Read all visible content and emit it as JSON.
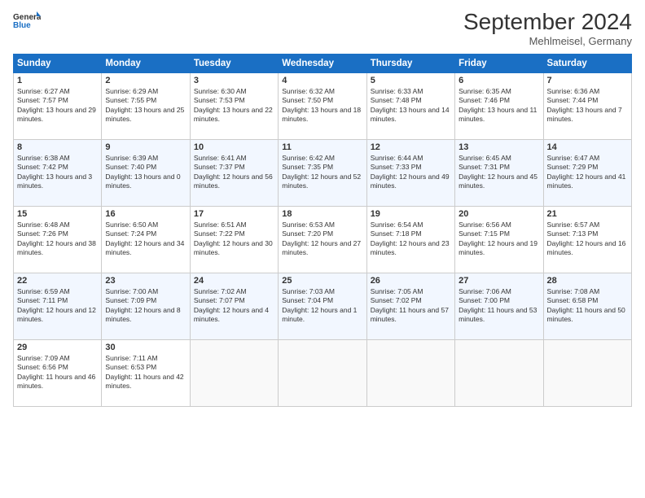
{
  "logo": {
    "line1": "General",
    "line2": "Blue"
  },
  "title": "September 2024",
  "subtitle": "Mehlmeisel, Germany",
  "weekdays": [
    "Sunday",
    "Monday",
    "Tuesday",
    "Wednesday",
    "Thursday",
    "Friday",
    "Saturday"
  ],
  "weeks": [
    [
      {
        "day": "1",
        "sunrise": "Sunrise: 6:27 AM",
        "sunset": "Sunset: 7:57 PM",
        "daylight": "Daylight: 13 hours and 29 minutes."
      },
      {
        "day": "2",
        "sunrise": "Sunrise: 6:29 AM",
        "sunset": "Sunset: 7:55 PM",
        "daylight": "Daylight: 13 hours and 25 minutes."
      },
      {
        "day": "3",
        "sunrise": "Sunrise: 6:30 AM",
        "sunset": "Sunset: 7:53 PM",
        "daylight": "Daylight: 13 hours and 22 minutes."
      },
      {
        "day": "4",
        "sunrise": "Sunrise: 6:32 AM",
        "sunset": "Sunset: 7:50 PM",
        "daylight": "Daylight: 13 hours and 18 minutes."
      },
      {
        "day": "5",
        "sunrise": "Sunrise: 6:33 AM",
        "sunset": "Sunset: 7:48 PM",
        "daylight": "Daylight: 13 hours and 14 minutes."
      },
      {
        "day": "6",
        "sunrise": "Sunrise: 6:35 AM",
        "sunset": "Sunset: 7:46 PM",
        "daylight": "Daylight: 13 hours and 11 minutes."
      },
      {
        "day": "7",
        "sunrise": "Sunrise: 6:36 AM",
        "sunset": "Sunset: 7:44 PM",
        "daylight": "Daylight: 13 hours and 7 minutes."
      }
    ],
    [
      {
        "day": "8",
        "sunrise": "Sunrise: 6:38 AM",
        "sunset": "Sunset: 7:42 PM",
        "daylight": "Daylight: 13 hours and 3 minutes."
      },
      {
        "day": "9",
        "sunrise": "Sunrise: 6:39 AM",
        "sunset": "Sunset: 7:40 PM",
        "daylight": "Daylight: 13 hours and 0 minutes."
      },
      {
        "day": "10",
        "sunrise": "Sunrise: 6:41 AM",
        "sunset": "Sunset: 7:37 PM",
        "daylight": "Daylight: 12 hours and 56 minutes."
      },
      {
        "day": "11",
        "sunrise": "Sunrise: 6:42 AM",
        "sunset": "Sunset: 7:35 PM",
        "daylight": "Daylight: 12 hours and 52 minutes."
      },
      {
        "day": "12",
        "sunrise": "Sunrise: 6:44 AM",
        "sunset": "Sunset: 7:33 PM",
        "daylight": "Daylight: 12 hours and 49 minutes."
      },
      {
        "day": "13",
        "sunrise": "Sunrise: 6:45 AM",
        "sunset": "Sunset: 7:31 PM",
        "daylight": "Daylight: 12 hours and 45 minutes."
      },
      {
        "day": "14",
        "sunrise": "Sunrise: 6:47 AM",
        "sunset": "Sunset: 7:29 PM",
        "daylight": "Daylight: 12 hours and 41 minutes."
      }
    ],
    [
      {
        "day": "15",
        "sunrise": "Sunrise: 6:48 AM",
        "sunset": "Sunset: 7:26 PM",
        "daylight": "Daylight: 12 hours and 38 minutes."
      },
      {
        "day": "16",
        "sunrise": "Sunrise: 6:50 AM",
        "sunset": "Sunset: 7:24 PM",
        "daylight": "Daylight: 12 hours and 34 minutes."
      },
      {
        "day": "17",
        "sunrise": "Sunrise: 6:51 AM",
        "sunset": "Sunset: 7:22 PM",
        "daylight": "Daylight: 12 hours and 30 minutes."
      },
      {
        "day": "18",
        "sunrise": "Sunrise: 6:53 AM",
        "sunset": "Sunset: 7:20 PM",
        "daylight": "Daylight: 12 hours and 27 minutes."
      },
      {
        "day": "19",
        "sunrise": "Sunrise: 6:54 AM",
        "sunset": "Sunset: 7:18 PM",
        "daylight": "Daylight: 12 hours and 23 minutes."
      },
      {
        "day": "20",
        "sunrise": "Sunrise: 6:56 AM",
        "sunset": "Sunset: 7:15 PM",
        "daylight": "Daylight: 12 hours and 19 minutes."
      },
      {
        "day": "21",
        "sunrise": "Sunrise: 6:57 AM",
        "sunset": "Sunset: 7:13 PM",
        "daylight": "Daylight: 12 hours and 16 minutes."
      }
    ],
    [
      {
        "day": "22",
        "sunrise": "Sunrise: 6:59 AM",
        "sunset": "Sunset: 7:11 PM",
        "daylight": "Daylight: 12 hours and 12 minutes."
      },
      {
        "day": "23",
        "sunrise": "Sunrise: 7:00 AM",
        "sunset": "Sunset: 7:09 PM",
        "daylight": "Daylight: 12 hours and 8 minutes."
      },
      {
        "day": "24",
        "sunrise": "Sunrise: 7:02 AM",
        "sunset": "Sunset: 7:07 PM",
        "daylight": "Daylight: 12 hours and 4 minutes."
      },
      {
        "day": "25",
        "sunrise": "Sunrise: 7:03 AM",
        "sunset": "Sunset: 7:04 PM",
        "daylight": "Daylight: 12 hours and 1 minute."
      },
      {
        "day": "26",
        "sunrise": "Sunrise: 7:05 AM",
        "sunset": "Sunset: 7:02 PM",
        "daylight": "Daylight: 11 hours and 57 minutes."
      },
      {
        "day": "27",
        "sunrise": "Sunrise: 7:06 AM",
        "sunset": "Sunset: 7:00 PM",
        "daylight": "Daylight: 11 hours and 53 minutes."
      },
      {
        "day": "28",
        "sunrise": "Sunrise: 7:08 AM",
        "sunset": "Sunset: 6:58 PM",
        "daylight": "Daylight: 11 hours and 50 minutes."
      }
    ],
    [
      {
        "day": "29",
        "sunrise": "Sunrise: 7:09 AM",
        "sunset": "Sunset: 6:56 PM",
        "daylight": "Daylight: 11 hours and 46 minutes."
      },
      {
        "day": "30",
        "sunrise": "Sunrise: 7:11 AM",
        "sunset": "Sunset: 6:53 PM",
        "daylight": "Daylight: 11 hours and 42 minutes."
      },
      null,
      null,
      null,
      null,
      null
    ]
  ]
}
